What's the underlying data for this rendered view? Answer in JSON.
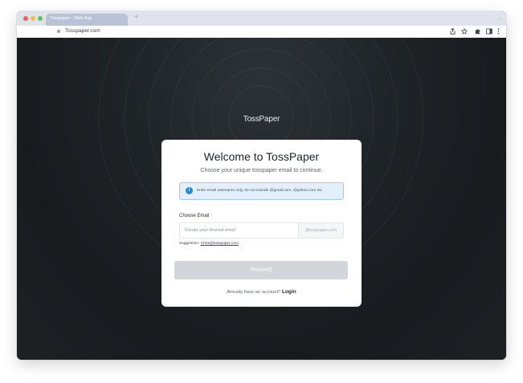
{
  "browser": {
    "tab_title": "Tosspaper - Web App",
    "new_tab_symbol": "+",
    "tab_menu_symbol": "⌄",
    "url": "Tosspaper.com",
    "icons": [
      "share-icon",
      "star-icon",
      "extensions-icon",
      "sidebar-icon",
      "more-icon"
    ]
  },
  "page": {
    "brand": "TossPaper",
    "title": "Welcome to TossPaper",
    "subtitle": "Choose your unique tosspaper email to continue.",
    "info_icon": "i",
    "info_text": "Enter email username only, do not include @gmail.com, @yahoo.com etc",
    "field_label": "Choose Email",
    "email_placeholder": "Create your desired email",
    "email_value": "",
    "email_suffix": "@tosspaper.com",
    "suggestion_label": "Suggestion:",
    "suggestion_value": "Chris@tosspaper.com",
    "proceed_label": "Proceed",
    "login_prompt": "Already have an account?",
    "login_link": "Login"
  },
  "colors": {
    "accent_info": "#2b86d6",
    "disabled_button": "#d2d5d9",
    "background_dark": "#1b1f22"
  }
}
